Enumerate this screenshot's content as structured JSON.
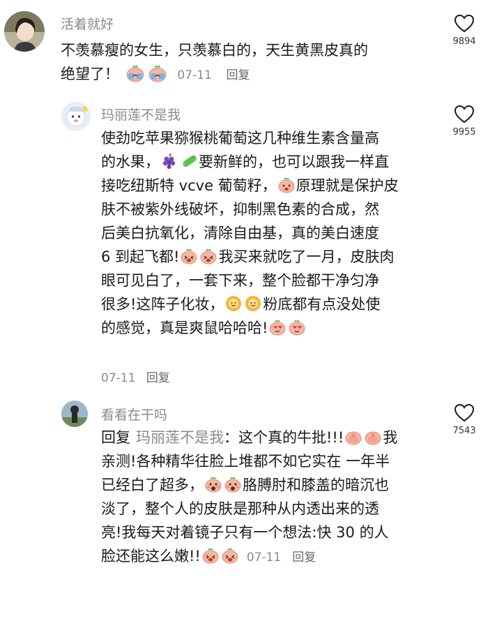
{
  "comments": [
    {
      "username": "活着就好",
      "lines": [
        "不羡慕瘦的女生，只羡慕白的，天生黄黑皮真的",
        "绝望了！"
      ],
      "emoji_after_line2": [
        "crying-peach",
        "crying-peach"
      ],
      "date": "07-11",
      "reply_label": "回复",
      "likes": "9894"
    },
    {
      "username": "玛丽莲不是我",
      "line1": "使劲吃苹果猕猴桃葡萄这几种维生素含量高",
      "line2a": "的水果，",
      "line2b": "要新鲜的，也可以跟我一样直",
      "line3a": "接吃纽斯特 vcve 葡萄籽，",
      "line3b": "原理就是保护皮",
      "line4": "肤不被紫外线破坏，抑制黑色素的合成，然",
      "line5": "后美白抗氧化，清除自由基，真的美白速度",
      "line6a": "6 到起飞都!",
      "line6b": "我买来就吃了一月，皮肤肉",
      "line7": "眼可见白了，一套下来，整个脸都干净匀净",
      "line8a": "很多!这阵子化妆，",
      "line8b": "粉底都有点没处使",
      "line9a": "的感觉，真是爽鼠哈哈哈!",
      "date": "07-11",
      "reply_label": "回复",
      "likes": "9955"
    },
    {
      "username": "看看在干吗",
      "reply_prefix": "回复",
      "mention": "玛丽莲不是我",
      "line1a": "：这个真的牛批!!!",
      "line1b": "我",
      "line2": "亲测!各种精华往脸上堆都不如它实在 一年半",
      "line3": "已经白了超多，",
      "line3b": "胳膊肘和膝盖的暗沉也",
      "line4": "淡了，整个人的皮肤是那种从内透出来的透",
      "line5": "亮!我每天对着镜子只有一个想法:快 30 的人",
      "line6": "脸还能这么嫩!!",
      "date": "07-11",
      "reply_label": "回复",
      "likes": "7543"
    }
  ],
  "colors": {
    "text": "#1a1a1a",
    "meta": "#8a8a8a",
    "peach": "#f7b9a6",
    "leaf": "#3fbf6a"
  }
}
